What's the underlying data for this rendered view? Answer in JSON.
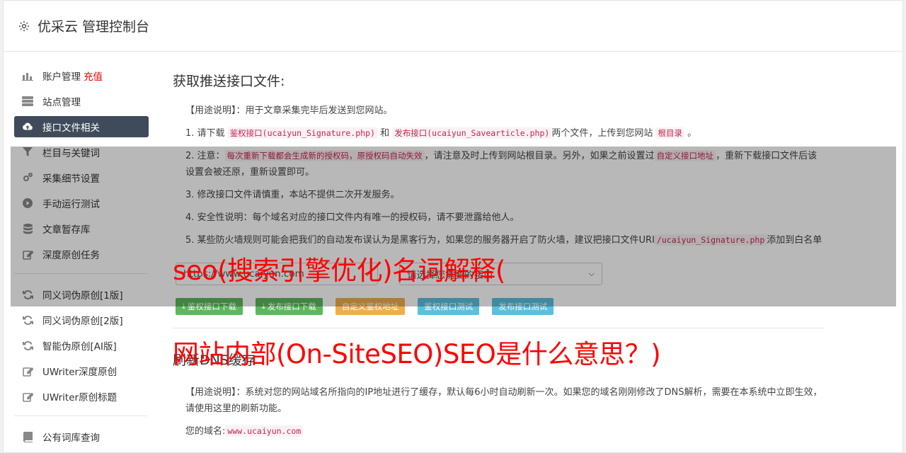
{
  "header": {
    "title": "优采云 管理控制台"
  },
  "sidebar": {
    "group1": [
      {
        "label": "账户管理",
        "badge": "充值",
        "icon": "bar-chart-icon"
      },
      {
        "label": "站点管理",
        "icon": "server-icon"
      },
      {
        "label": "接口文件相关",
        "icon": "cloud-upload-icon",
        "active": true
      },
      {
        "label": "栏目与关键词",
        "icon": "filter-icon"
      },
      {
        "label": "采集细节设置",
        "icon": "cogs-icon"
      },
      {
        "label": "手动运行测试",
        "icon": "play-icon"
      },
      {
        "label": "文章暂存库",
        "icon": "database-icon"
      },
      {
        "label": "深度原创任务",
        "icon": "edit-icon"
      }
    ],
    "group2": [
      {
        "label": "同义词伪原创[1版]",
        "icon": "refresh-icon"
      },
      {
        "label": "同义词伪原创[2版]",
        "icon": "refresh-icon"
      },
      {
        "label": "智能伪原创[AI版]",
        "icon": "refresh-icon"
      },
      {
        "label": "UWriter深度原创",
        "icon": "edit-icon"
      },
      {
        "label": "UWriter原创标题",
        "icon": "edit-icon"
      }
    ],
    "group3": [
      {
        "label": "公有词库查询",
        "icon": "book-icon"
      }
    ]
  },
  "section1": {
    "title": "获取推送接口文件:",
    "usage_tag": "【用途说明】",
    "usage_text": "：用于文章采集完毕后发送到您网站。",
    "p1_a": "1. 请下载",
    "p1_code1": "鉴权接口(ucaiyun_Signature.php)",
    "p1_and": "和",
    "p1_code2": "发布接口(ucaiyun_Savearticle.php)",
    "p1_b": "两个文件，上传到您网站",
    "p1_code3": "根目录",
    "p1_c": "。",
    "p2_a": "2. 注意：",
    "p2_code1": "每次重新下载都会生成新的授权码，原授权码自动失效",
    "p2_b": "，请注意及时上传到网站根目录。另外，如果之前设置过",
    "p2_code2": "自定义接口地址",
    "p2_c": "，重新下载接口文件后该设置会被还原，重新设置即可。",
    "p3": "3. 修改接口文件请慎重，本站不提供二次开发服务。",
    "p4": "4. 安全性说明：每个域名对应的接口文件内有唯一的授权码，请不要泄露给他人。",
    "p5_a": "5. 某些防火墙规则可能会把我们的自动发布误认为是黑客行为，如果您的服务器开启了防火墙，建议把接口文件URI",
    "p5_code": "/ucaiyun_Signature.php",
    "p5_b": "添加到白名单",
    "select_site": "https://www.ucaiyun.com",
    "select_api": "请选择您需要的接口",
    "btn_sign_download": "鉴权接口下载",
    "btn_publish_download": "发布接口下载",
    "btn_custom_sign": "自定义鉴权地址",
    "btn_sign_test": "鉴权接口测试",
    "btn_publish_test": "发布接口测试"
  },
  "section2": {
    "title": "刷新DNS缓存",
    "usage_tag": "【用途说明】",
    "usage_text": "：系统对您的网站域名所指向的IP地址进行了缓存，默认每6小时自动刷新一次。如果您的域名刚刚修改了DNS解析，需要在本系统中立即生效，请使用这里的刷新功能。",
    "domain_label": "您的域名:",
    "domain_value": "www.ucaiyun.com"
  },
  "watermarks": {
    "line1": "seo(搜索引擎优化)名词解释(",
    "line2": "网站内部(On-SiteSEO)SEO是什么意思？)"
  }
}
